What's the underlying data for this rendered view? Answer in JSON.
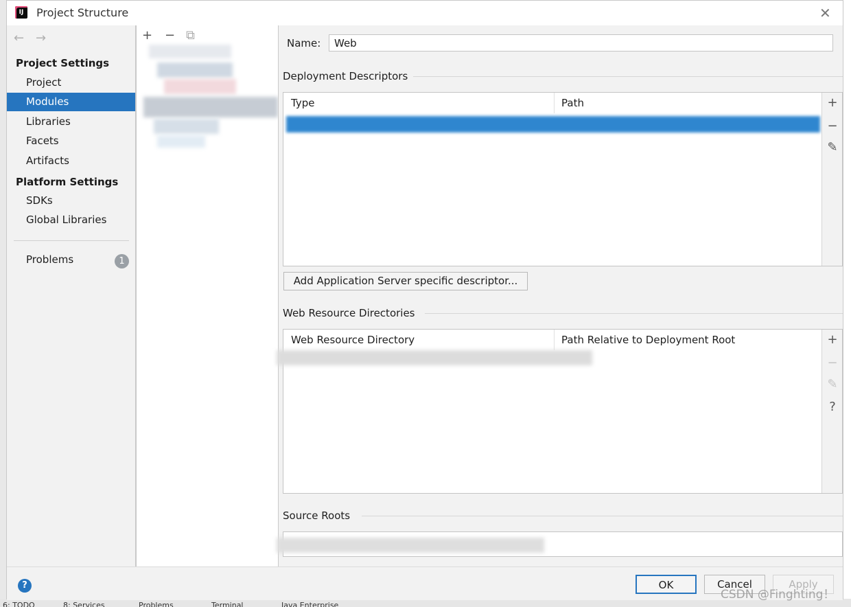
{
  "dialog": {
    "title": "Project Structure",
    "close_glyph": "✕",
    "icon_text": "IJ"
  },
  "nav": {
    "back_glyph": "←",
    "forward_glyph": "→",
    "project_settings_header": "Project Settings",
    "project_settings_items": [
      "Project",
      "Modules",
      "Libraries",
      "Facets",
      "Artifacts"
    ],
    "selected_item": "Modules",
    "platform_settings_header": "Platform Settings",
    "platform_settings_items": [
      "SDKs",
      "Global Libraries"
    ],
    "problems_label": "Problems",
    "problems_count": "1"
  },
  "module_list": {
    "add_glyph": "+",
    "remove_glyph": "−",
    "copy_glyph": "⧉"
  },
  "module": {
    "name_label": "Name:",
    "name_value": "Web",
    "deployment_descriptors": {
      "title": "Deployment Descriptors",
      "columns": [
        "Type",
        "Path"
      ],
      "add_server_button": "Add Application Server specific descriptor..."
    },
    "web_resource_directories": {
      "title": "Web Resource Directories",
      "columns": [
        "Web Resource Directory",
        "Path Relative to Deployment Root"
      ]
    },
    "source_roots": {
      "title": "Source Roots"
    },
    "tool_glyphs": {
      "add": "+",
      "remove": "−",
      "edit": "✎",
      "help": "?"
    }
  },
  "buttons": {
    "ok": "OK",
    "cancel": "Cancel",
    "apply": "Apply",
    "help": "?"
  },
  "background": {
    "bottom_tabs": [
      "6: TODO",
      "8: Services",
      "Problems",
      "Terminal",
      "Java Enterprise"
    ]
  },
  "watermark": "CSDN @Finghting！",
  "colors": {
    "selection": "#2675bf",
    "ok_border": "#2675bf"
  }
}
